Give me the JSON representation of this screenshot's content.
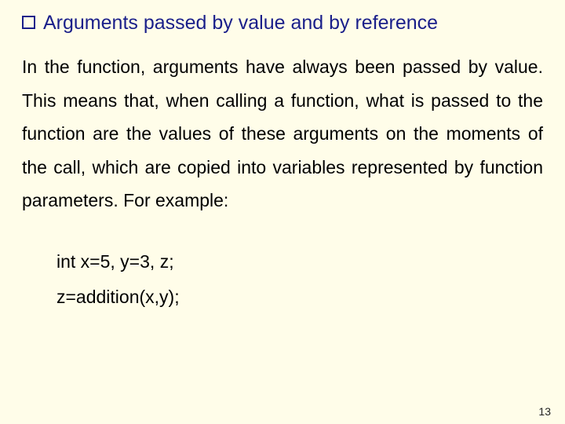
{
  "heading": "Arguments passed by value and by reference",
  "body": "In the function, arguments have always been passed by value. This means that, when calling a function, what is passed to the function are the values of these arguments on the moments of the call, which are copied into variables represented by function parameters. For example:",
  "code": {
    "line1": "int x=5, y=3, z;",
    "line2": "z=addition(x,y);"
  },
  "page_number": "13"
}
